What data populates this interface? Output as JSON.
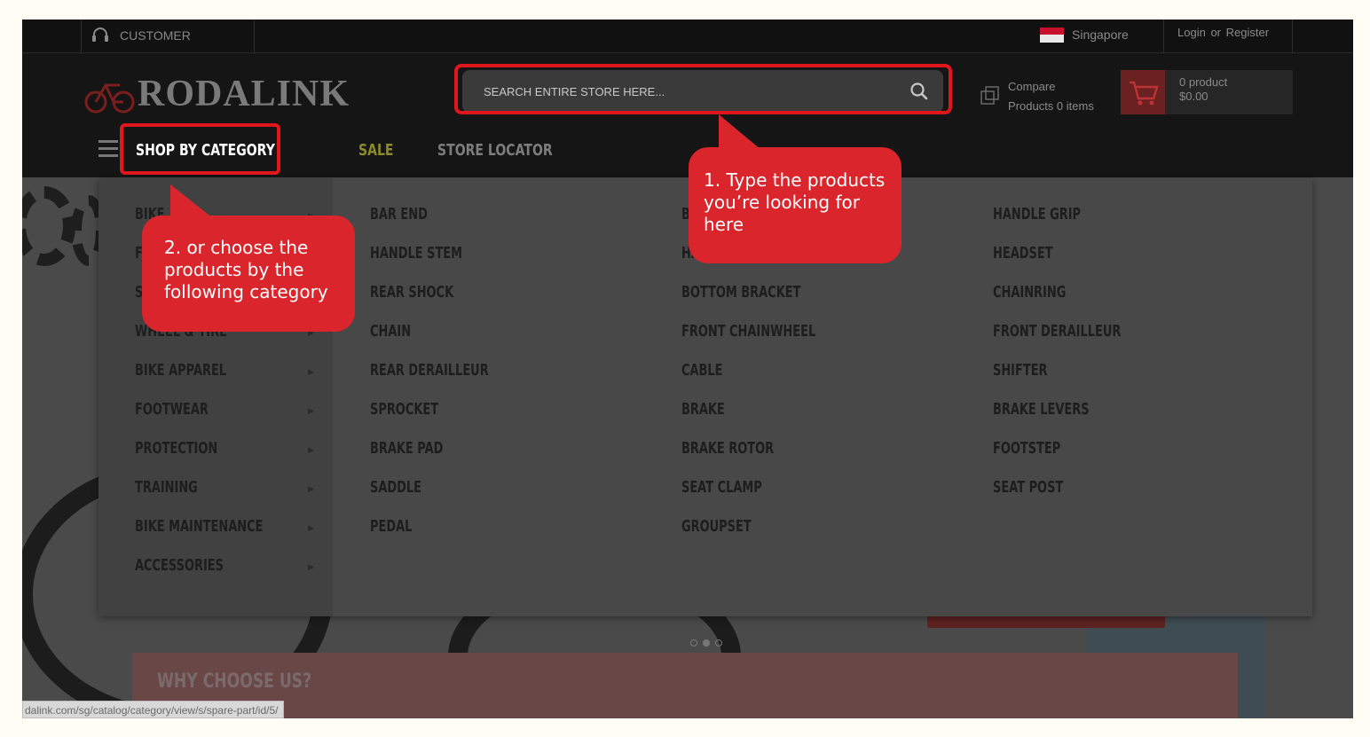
{
  "topbar": {
    "support_label": "CUSTOMER SUPPORT",
    "country": "Singapore",
    "login": "Login",
    "or": "or",
    "register": "Register"
  },
  "header": {
    "logo_text": "RODALINK",
    "search_placeholder": "SEARCH ENTIRE STORE HERE...",
    "compare_line1": "Compare",
    "compare_line2": "Products 0 items",
    "cart_count": "0 product",
    "cart_total": "$0.00"
  },
  "nav": {
    "shop_by_category": "SHOP BY CATEGORY",
    "sale": "SALE",
    "store_locator": "STORE LOCATOR"
  },
  "menu": {
    "categories": [
      "BIKE",
      "F",
      "S",
      "WHEEL & TIRE",
      "BIKE APPAREL",
      "FOOTWEAR",
      "PROTECTION",
      "TRAINING",
      "BIKE MAINTENANCE",
      "ACCESSORIES"
    ],
    "col1": [
      "BAR END",
      "HANDLE STEM",
      "REAR SHOCK",
      "CHAIN",
      "REAR DERAILLEUR",
      "SPROCKET",
      "BRAKE PAD",
      "SADDLE",
      "PEDAL"
    ],
    "col2": [
      "B",
      "HAN",
      "BOTTOM BRACKET",
      "FRONT CHAINWHEEL",
      "CABLE",
      "BRAKE",
      "BRAKE ROTOR",
      "SEAT CLAMP",
      "GROUPSET"
    ],
    "col3": [
      "HANDLE GRIP",
      "HEADSET",
      "CHAINRING",
      "FRONT DERAILLEUR",
      "SHIFTER",
      "BRAKE LEVERS",
      "FOOTSTEP",
      "SEAT POST"
    ]
  },
  "hero": {
    "why_choose": "WHY CHOOSE US?"
  },
  "status_url": "dalink.com/sg/catalog/category/view/s/spare-part/id/5/",
  "annotations": {
    "bubble1": "1. Type the products you’re looking for here",
    "bubble2": "2. or choose the products by the following category",
    "color": "#d9252b"
  }
}
